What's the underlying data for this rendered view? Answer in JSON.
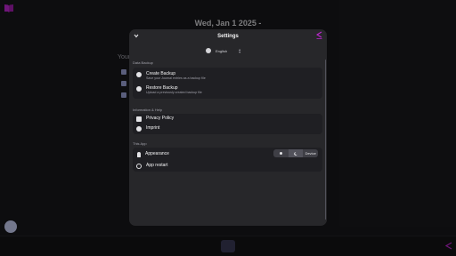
{
  "background": {
    "date_title": "Wed, Jan 1 2025 -",
    "section_heading": "Your"
  },
  "settings": {
    "title": "Settings",
    "language": "English",
    "data_backup": {
      "label": "Data Backup",
      "create": {
        "title": "Create Backup",
        "subtitle": "Save your Journal entries as a backup file"
      },
      "restore": {
        "title": "Restore Backup",
        "subtitle": "Upload a previously created backup file"
      }
    },
    "info_help": {
      "label": "Information & Help",
      "privacy": "Privacy Policy",
      "imprint": "Imprint"
    },
    "this_app": {
      "label": "This App",
      "appearance": "Appearance",
      "appearance_options": {
        "light": "sun-icon",
        "dark": "moon-icon",
        "device": "Device"
      },
      "restart": "App restart"
    }
  },
  "colors": {
    "accent": "#c026d3",
    "modal_bg": "#27272a",
    "card_bg": "#1f1f23",
    "page_bg": "#18181b"
  }
}
